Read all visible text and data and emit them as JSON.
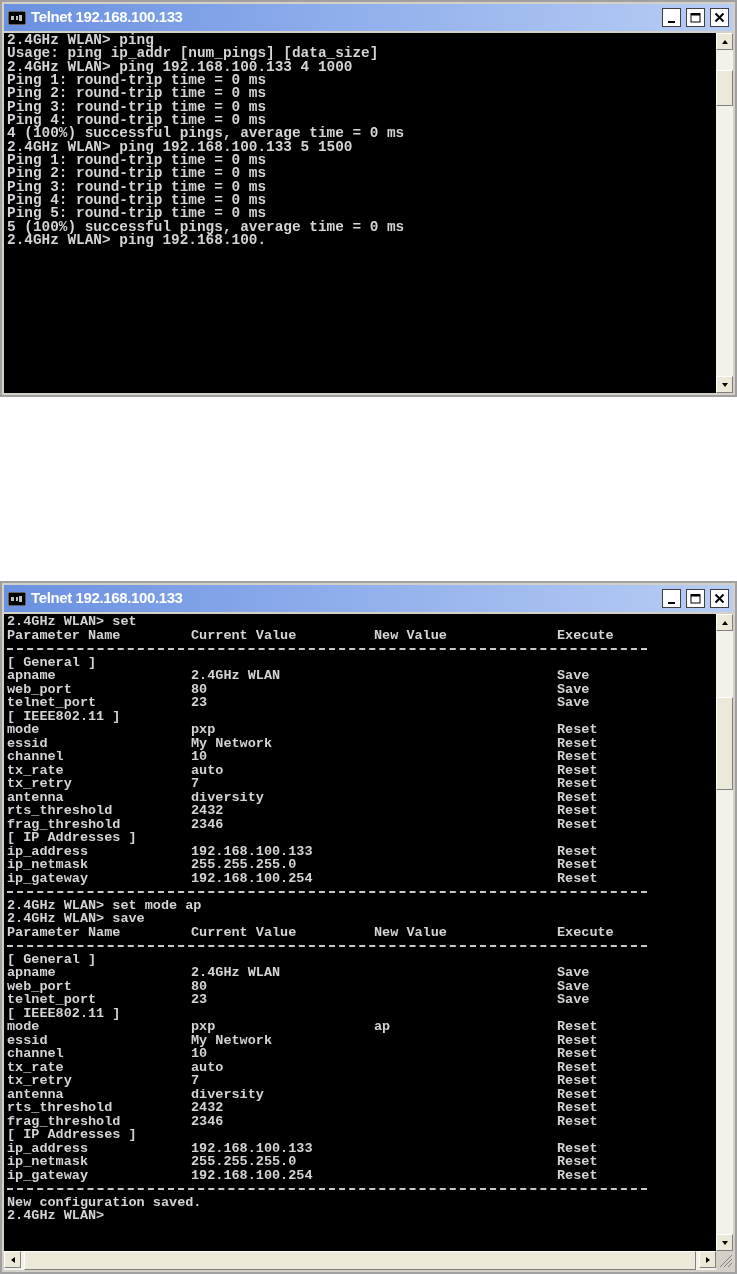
{
  "windows": [
    {
      "title": "Telnet 192.168.100.133",
      "horizontal_scrollbar": false,
      "lines": [
        {
          "kind": "text",
          "text": "2.4GHz WLAN> ping"
        },
        {
          "kind": "text",
          "text": "Usage: ping ip_addr [num_pings] [data_size]"
        },
        {
          "kind": "text",
          "text": "2.4GHz WLAN> ping 192.168.100.133 4 1000"
        },
        {
          "kind": "text",
          "text": "Ping 1: round-trip time = 0 ms"
        },
        {
          "kind": "text",
          "text": "Ping 2: round-trip time = 0 ms"
        },
        {
          "kind": "text",
          "text": "Ping 3: round-trip time = 0 ms"
        },
        {
          "kind": "text",
          "text": "Ping 4: round-trip time = 0 ms"
        },
        {
          "kind": "text",
          "text": "4 (100%) successful pings, average time = 0 ms"
        },
        {
          "kind": "text",
          "text": "2.4GHz WLAN> ping 192.168.100.133 5 1500"
        },
        {
          "kind": "text",
          "text": "Ping 1: round-trip time = 0 ms"
        },
        {
          "kind": "text",
          "text": "Ping 2: round-trip time = 0 ms"
        },
        {
          "kind": "text",
          "text": "Ping 3: round-trip time = 0 ms"
        },
        {
          "kind": "text",
          "text": "Ping 4: round-trip time = 0 ms"
        },
        {
          "kind": "text",
          "text": "Ping 5: round-trip time = 0 ms"
        },
        {
          "kind": "text",
          "text": "5 (100%) successful pings, average time = 0 ms"
        },
        {
          "kind": "text",
          "text": "2.4GHz WLAN> ping 192.168.100."
        }
      ]
    },
    {
      "title": "Telnet 192.168.100.133",
      "horizontal_scrollbar": true,
      "lines": [
        {
          "kind": "text",
          "text": "2.4GHz WLAN> set"
        },
        {
          "kind": "header",
          "cells": [
            "Parameter Name",
            "Current Value",
            "New Value",
            "Execute"
          ]
        },
        {
          "kind": "rule"
        },
        {
          "kind": "text",
          "text": "[ General ]"
        },
        {
          "kind": "row",
          "cells": [
            "apname",
            "2.4GHz WLAN",
            null,
            "Save"
          ]
        },
        {
          "kind": "row",
          "cells": [
            "web_port",
            "80",
            null,
            "Save"
          ]
        },
        {
          "kind": "row",
          "cells": [
            "telnet_port",
            "23",
            null,
            "Save"
          ]
        },
        {
          "kind": "text",
          "text": "[ IEEE802.11 ]"
        },
        {
          "kind": "row",
          "cells": [
            "mode",
            "pxp",
            null,
            "Reset"
          ]
        },
        {
          "kind": "row",
          "cells": [
            "essid",
            "My Network",
            null,
            "Reset"
          ]
        },
        {
          "kind": "row",
          "cells": [
            "channel",
            "10",
            null,
            "Reset"
          ]
        },
        {
          "kind": "row",
          "cells": [
            "tx_rate",
            "auto",
            null,
            "Reset"
          ]
        },
        {
          "kind": "row",
          "cells": [
            "tx_retry",
            "7",
            null,
            "Reset"
          ]
        },
        {
          "kind": "row",
          "cells": [
            "antenna",
            "diversity",
            null,
            "Reset"
          ]
        },
        {
          "kind": "row",
          "cells": [
            "rts_threshold",
            "2432",
            null,
            "Reset"
          ]
        },
        {
          "kind": "row",
          "cells": [
            "frag_threshold",
            "2346",
            null,
            "Reset"
          ]
        },
        {
          "kind": "text",
          "text": "[ IP Addresses ]"
        },
        {
          "kind": "row",
          "cells": [
            "ip_address",
            "192.168.100.133",
            null,
            "Reset"
          ]
        },
        {
          "kind": "row",
          "cells": [
            "ip_netmask",
            "255.255.255.0",
            null,
            "Reset"
          ]
        },
        {
          "kind": "row",
          "cells": [
            "ip_gateway",
            "192.168.100.254",
            null,
            "Reset"
          ]
        },
        {
          "kind": "rule"
        },
        {
          "kind": "text",
          "text": "2.4GHz WLAN> set mode ap"
        },
        {
          "kind": "text",
          "text": "2.4GHz WLAN> save"
        },
        {
          "kind": "header",
          "cells": [
            "Parameter Name",
            "Current Value",
            "New Value",
            "Execute"
          ]
        },
        {
          "kind": "rule"
        },
        {
          "kind": "text",
          "text": "[ General ]"
        },
        {
          "kind": "row",
          "cells": [
            "apname",
            "2.4GHz WLAN",
            null,
            "Save"
          ]
        },
        {
          "kind": "row",
          "cells": [
            "web_port",
            "80",
            null,
            "Save"
          ]
        },
        {
          "kind": "row",
          "cells": [
            "telnet_port",
            "23",
            null,
            "Save"
          ]
        },
        {
          "kind": "text",
          "text": "[ IEEE802.11 ]"
        },
        {
          "kind": "row",
          "cells": [
            "mode",
            "pxp",
            "ap",
            "Reset"
          ]
        },
        {
          "kind": "row",
          "cells": [
            "essid",
            "My Network",
            null,
            "Reset"
          ]
        },
        {
          "kind": "row",
          "cells": [
            "channel",
            "10",
            null,
            "Reset"
          ]
        },
        {
          "kind": "row",
          "cells": [
            "tx_rate",
            "auto",
            null,
            "Reset"
          ]
        },
        {
          "kind": "row",
          "cells": [
            "tx_retry",
            "7",
            null,
            "Reset"
          ]
        },
        {
          "kind": "row",
          "cells": [
            "antenna",
            "diversity",
            null,
            "Reset"
          ]
        },
        {
          "kind": "row",
          "cells": [
            "rts_threshold",
            "2432",
            null,
            "Reset"
          ]
        },
        {
          "kind": "row",
          "cells": [
            "frag_threshold",
            "2346",
            null,
            "Reset"
          ]
        },
        {
          "kind": "text",
          "text": "[ IP Addresses ]"
        },
        {
          "kind": "row",
          "cells": [
            "ip_address",
            "192.168.100.133",
            null,
            "Reset"
          ]
        },
        {
          "kind": "row",
          "cells": [
            "ip_netmask",
            "255.255.255.0",
            null,
            "Reset"
          ]
        },
        {
          "kind": "row",
          "cells": [
            "ip_gateway",
            "192.168.100.254",
            null,
            "Reset"
          ]
        },
        {
          "kind": "rule"
        },
        {
          "kind": "text",
          "text": "New configuration saved."
        },
        {
          "kind": "text",
          "text": "2.4GHz WLAN>"
        }
      ]
    }
  ]
}
